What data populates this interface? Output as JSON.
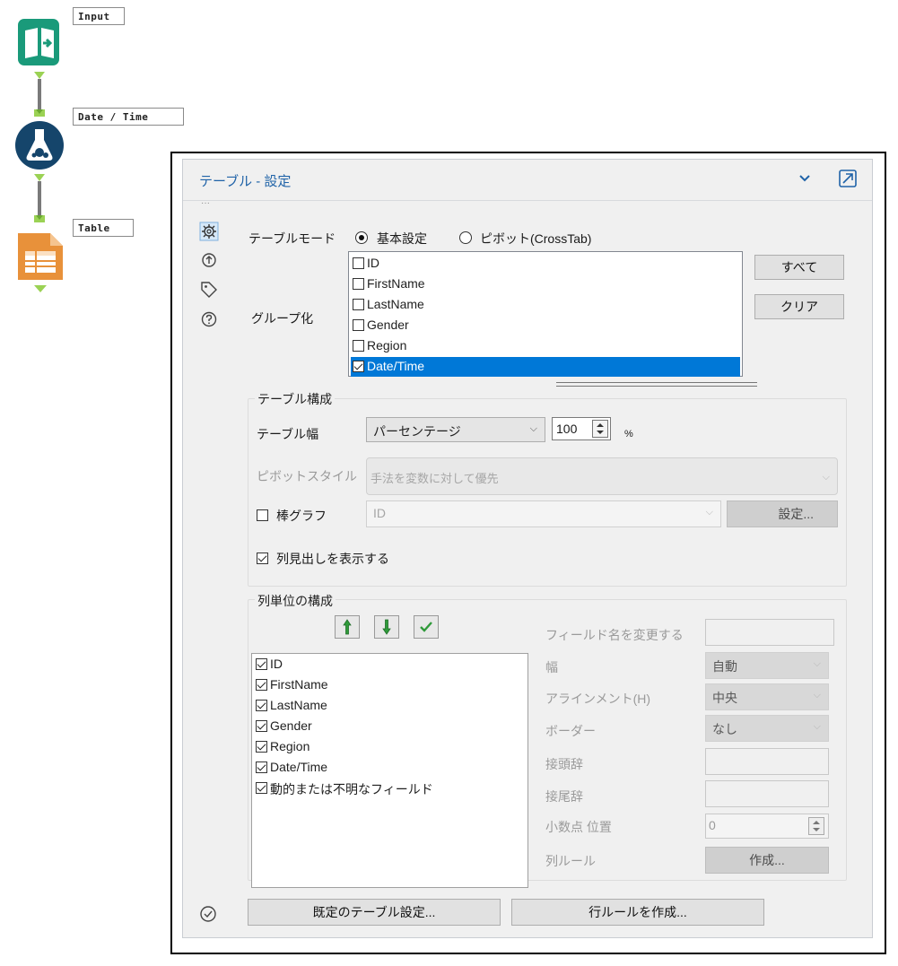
{
  "workflow": {
    "tools": [
      {
        "name": "Input",
        "icon": "input-book-icon"
      },
      {
        "name": "Date / Time",
        "icon": "flask-icon"
      },
      {
        "name": "Table",
        "icon": "table-icon"
      }
    ]
  },
  "panel": {
    "title": "テーブル - 設定",
    "icons": [
      "chevron-down-icon",
      "popout-icon",
      "gear-icon",
      "help-icon"
    ],
    "table_mode": {
      "label": "テーブルモード",
      "options": [
        "基本設定",
        "ピボット(CrossTab)"
      ],
      "selected": "基本設定"
    },
    "grouping": {
      "label": "グループ化",
      "fields": [
        {
          "name": "ID",
          "checked": false
        },
        {
          "name": "FirstName",
          "checked": false
        },
        {
          "name": "LastName",
          "checked": false
        },
        {
          "name": "Gender",
          "checked": false
        },
        {
          "name": "Region",
          "checked": false
        },
        {
          "name": "Date/Time",
          "checked": true
        }
      ],
      "all_button": "すべて",
      "clear_button": "クリア"
    },
    "table_config": {
      "title": "テーブル構成",
      "width_label": "テーブル幅",
      "width_mode": "パーセンテージ",
      "width_value": "100",
      "width_unit": "%",
      "pivot_style_label": "ピボットスタイル",
      "pivot_style_value": "手法を変数に対して優先",
      "bar_graph_label": "棒グラフ",
      "bar_graph_checked": false,
      "bar_graph_field": "ID",
      "bar_graph_settings_button": "設定...",
      "show_headers_label": "列見出しを表示する",
      "show_headers_checked": true
    },
    "column_config": {
      "title": "列単位の構成",
      "columns": [
        {
          "name": "ID",
          "checked": true
        },
        {
          "name": "FirstName",
          "checked": true
        },
        {
          "name": "LastName",
          "checked": true
        },
        {
          "name": "Gender",
          "checked": true
        },
        {
          "name": "Region",
          "checked": true
        },
        {
          "name": "Date/Time",
          "checked": true
        },
        {
          "name": "動的または不明なフィールド",
          "checked": true
        }
      ],
      "rename_label": "フィールド名を変更する",
      "rename_value": "",
      "width_label": "幅",
      "width_value": "自動",
      "align_label": "アラインメント(H)",
      "align_value": "中央",
      "border_label": "ボーダー",
      "border_value": "なし",
      "prefix_label": "接頭辞",
      "prefix_value": "",
      "suffix_label": "接尾辞",
      "suffix_value": "",
      "decimal_label": "小数点 位置",
      "decimal_value": "0",
      "column_rule_label": "列ルール",
      "column_rule_button": "作成..."
    },
    "footer": {
      "default_table_button": "既定のテーブル設定...",
      "row_rule_button": "行ルールを作成..."
    }
  },
  "colors": {
    "accent_blue": "#2063a8",
    "selection_blue": "#0078d7",
    "tool_green": "#1a9a7a",
    "tool_navy": "#15456b",
    "tool_orange": "#e8913a",
    "anchor_green": "#9bd254"
  }
}
